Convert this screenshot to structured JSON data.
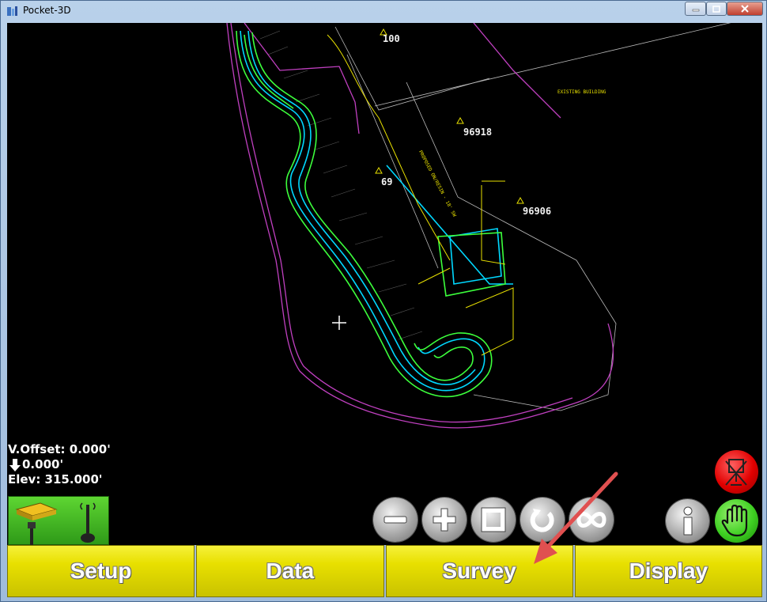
{
  "window": {
    "title": "Pocket-3D"
  },
  "map": {
    "point_labels": [
      "100",
      "96918",
      "69",
      "96906"
    ],
    "small_labels": [
      "EXISTING BUILDING",
      "PROPOSED ON/RESIN - 18' SW"
    ]
  },
  "readout": {
    "v_offset": "V.Offset: 0.000'",
    "cut_fill": "0.000'",
    "elev": "Elev: 315.000'"
  },
  "toolbar": {
    "zoom_out": "zoom-out",
    "zoom_in": "zoom-in",
    "zoom_extents": "zoom-extents",
    "rotate": "rotate",
    "fit": "fit-view"
  },
  "tabs": {
    "setup": "Setup",
    "data": "Data",
    "survey": "Survey",
    "display": "Display"
  },
  "colors": {
    "tab": "#e8e000",
    "map_bg": "#000000",
    "green_line": "#3cff3c",
    "cyan_line": "#00e0ff",
    "magenta_line": "#d040d0",
    "yellow_line": "#e8e000",
    "arrow": "#e05050"
  }
}
